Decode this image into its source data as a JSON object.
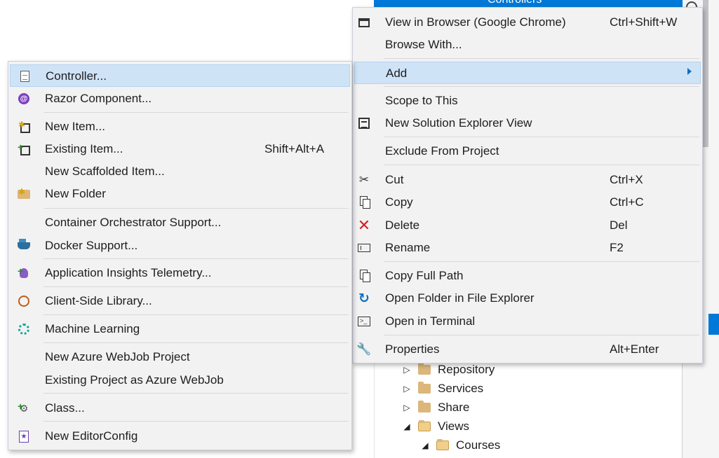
{
  "explorer": {
    "top_item": "Controllers",
    "tree": [
      {
        "label": "Repository",
        "expanded": false
      },
      {
        "label": "Services",
        "expanded": false
      },
      {
        "label": "Share",
        "expanded": false
      },
      {
        "label": "Views",
        "expanded": true
      },
      {
        "label": "Courses",
        "expanded": true
      }
    ]
  },
  "context_menu": {
    "items": [
      {
        "label": "View in Browser (Google Chrome)",
        "shortcut": "Ctrl+Shift+W",
        "icon": "browser-icon"
      },
      {
        "label": "Browse With...",
        "shortcut": "",
        "icon": ""
      },
      {
        "label": "Add",
        "shortcut": "",
        "icon": "",
        "submenu": true
      },
      {
        "label": "Scope to This",
        "shortcut": "",
        "icon": ""
      },
      {
        "label": "New Solution Explorer View",
        "shortcut": "",
        "icon": "solution-explorer-view-icon"
      },
      {
        "label": "Exclude From Project",
        "shortcut": "",
        "icon": ""
      },
      {
        "label": "Cut",
        "shortcut": "Ctrl+X",
        "icon": "scissors-icon"
      },
      {
        "label": "Copy",
        "shortcut": "Ctrl+C",
        "icon": "copy-icon"
      },
      {
        "label": "Delete",
        "shortcut": "Del",
        "icon": "delete-x-icon"
      },
      {
        "label": "Rename",
        "shortcut": "F2",
        "icon": "rename-icon"
      },
      {
        "label": "Copy Full Path",
        "shortcut": "",
        "icon": "copy-path-icon"
      },
      {
        "label": "Open Folder in File Explorer",
        "shortcut": "",
        "icon": "open-folder-arrow-icon"
      },
      {
        "label": "Open in Terminal",
        "shortcut": "",
        "icon": "terminal-icon"
      },
      {
        "label": "Properties",
        "shortcut": "Alt+Enter",
        "icon": "wrench-icon"
      }
    ]
  },
  "add_menu": {
    "items": [
      {
        "label": "Controller...",
        "shortcut": "",
        "icon": "controller-file-icon"
      },
      {
        "label": "Razor Component...",
        "shortcut": "",
        "icon": "razor-icon"
      },
      {
        "label": "New Item...",
        "shortcut": "",
        "icon": "new-item-icon"
      },
      {
        "label": "Existing Item...",
        "shortcut": "Shift+Alt+A",
        "icon": "existing-item-icon"
      },
      {
        "label": "New Scaffolded Item...",
        "shortcut": "",
        "icon": ""
      },
      {
        "label": "New Folder",
        "shortcut": "",
        "icon": "new-folder-icon"
      },
      {
        "label": "Container Orchestrator Support...",
        "shortcut": "",
        "icon": ""
      },
      {
        "label": "Docker Support...",
        "shortcut": "",
        "icon": "docker-icon"
      },
      {
        "label": "Application Insights Telemetry...",
        "shortcut": "",
        "icon": "app-insights-icon"
      },
      {
        "label": "Client-Side Library...",
        "shortcut": "",
        "icon": "client-library-globe-icon"
      },
      {
        "label": "Machine Learning",
        "shortcut": "",
        "icon": "machine-learning-gear-icon"
      },
      {
        "label": "New Azure WebJob Project",
        "shortcut": "",
        "icon": ""
      },
      {
        "label": "Existing Project as Azure WebJob",
        "shortcut": "",
        "icon": ""
      },
      {
        "label": "Class...",
        "shortcut": "",
        "icon": "class-icon"
      },
      {
        "label": "New EditorConfig",
        "shortcut": "",
        "icon": "editorconfig-icon"
      }
    ]
  },
  "colors": {
    "highlight": "#cfe3f7",
    "menu_bg": "#f2f2f2",
    "accent": "#0078d7",
    "submenu_arrow": "#0e70c0"
  }
}
